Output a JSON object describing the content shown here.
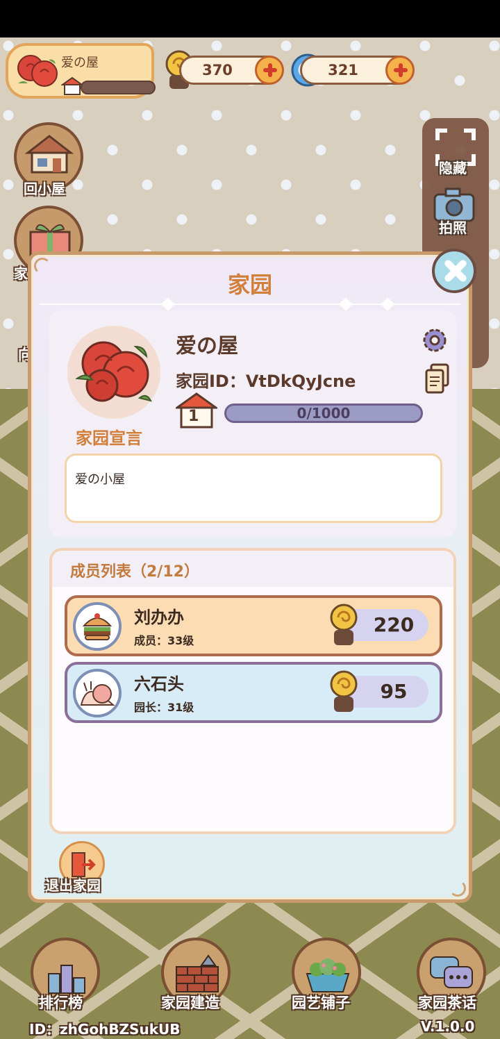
{
  "top_bar": {
    "home_name": "爱の屋",
    "home_level": "1",
    "snail_currency": "370",
    "spiral_currency": "321"
  },
  "left_menu": {
    "back_home_label": "回小屋",
    "gift_label_partial": "家",
    "third_label_partial": "向"
  },
  "right_tools": {
    "hide_label": "隐藏",
    "photo_label": "拍照"
  },
  "dialog": {
    "title": "家园",
    "home_name": "爱の屋",
    "home_id": "家园ID：VtDkQyJcne",
    "level": "1",
    "progress_text": "0/1000",
    "progress_value": 0,
    "progress_max": 1000,
    "declaration_label": "家园宣言",
    "declaration_text": "爱の小屋",
    "members_title": "成员列表（2/12）",
    "members": [
      {
        "name": "刘办办",
        "role": "成员：33级",
        "points": "220"
      },
      {
        "name": "六石头",
        "role": "园长：31级",
        "points": "95"
      }
    ],
    "exit_label": "退出家园"
  },
  "bottom_nav": {
    "items": [
      {
        "label": "排行榜"
      },
      {
        "label": "家园建造"
      },
      {
        "label": "园艺铺子"
      },
      {
        "label": "家园茶话"
      }
    ]
  },
  "footer": {
    "user_id": "ID：zhGohBZSukUB",
    "version": "V.1.0.0"
  },
  "colors": {
    "dialog_border": "#c89a6c",
    "title_orange": "#d17f3b",
    "row_member": "#fbdcb3",
    "row_leader": "#d8ecf7"
  }
}
